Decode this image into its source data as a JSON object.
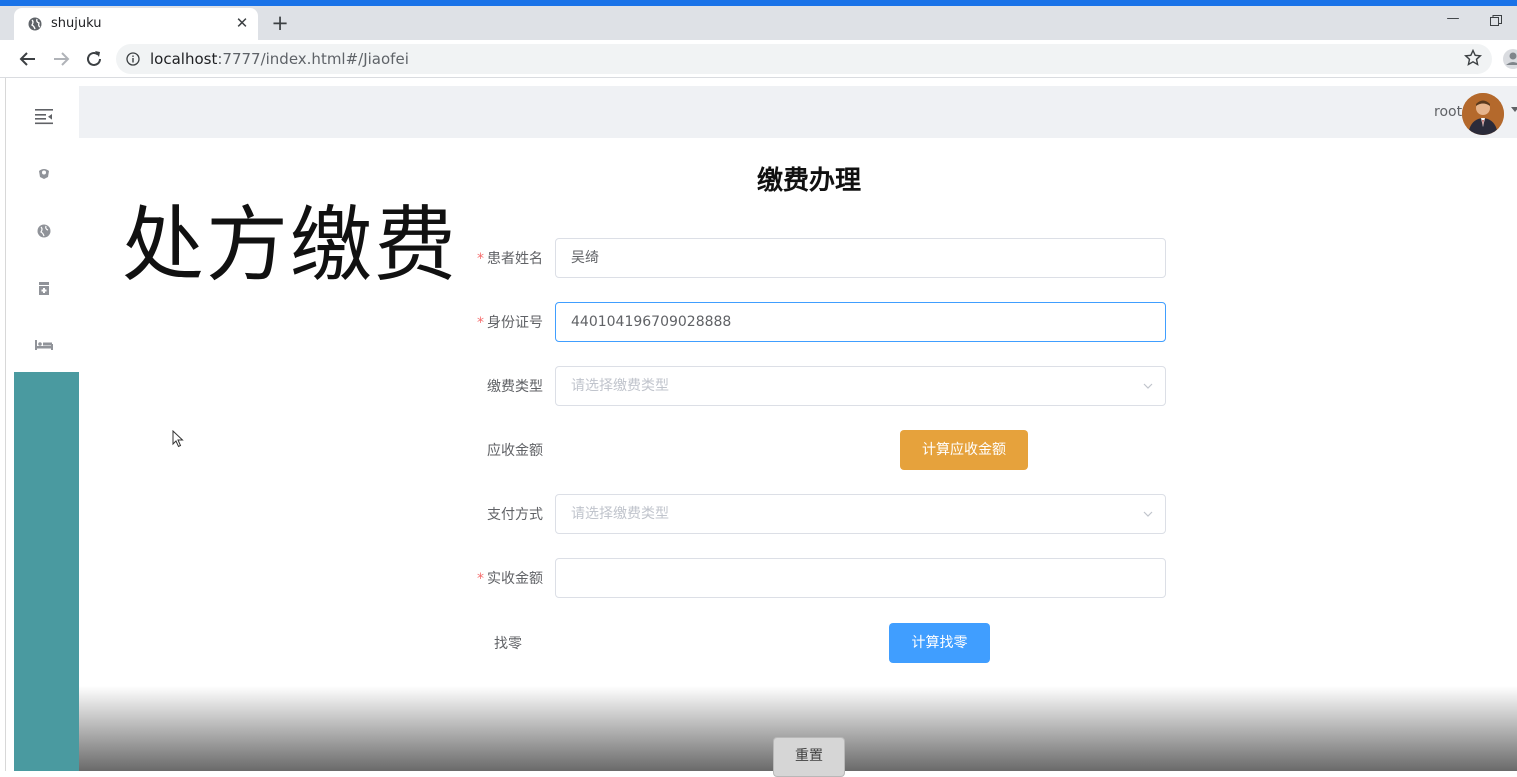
{
  "browser": {
    "tab_title": "shujuku",
    "tab_close": "✕",
    "new_tab": "+",
    "minimize": "—",
    "url_host": "localhost",
    "url_rest": ":7777/index.html#/Jiaofei"
  },
  "header": {
    "username": "root"
  },
  "sidebar": {
    "items": [
      {
        "icon": "menu-fold-icon"
      },
      {
        "icon": "user-shield-icon"
      },
      {
        "icon": "globe-icon"
      },
      {
        "icon": "medicine-box-icon"
      },
      {
        "icon": "bed-icon"
      }
    ],
    "accent_color": "#4a9aa0"
  },
  "main": {
    "big_title": "处方缴费",
    "form_title": "缴费办理",
    "fields": {
      "patient_name": {
        "label": "患者姓名",
        "value": "吴绮",
        "required": true
      },
      "id_number": {
        "label": "身份证号",
        "value": "440104196709028888",
        "required": true
      },
      "fee_type": {
        "label": "缴费类型",
        "placeholder": "请选择缴费类型"
      },
      "receivable": {
        "label": "应收金额"
      },
      "payment_method": {
        "label": "支付方式",
        "placeholder": "请选择缴费类型"
      },
      "actual_amount": {
        "label": "实收金额",
        "value": "",
        "required": true
      },
      "change": {
        "label": "找零"
      }
    },
    "required_mark": "*",
    "calc_receivable_button": "计算应收金额",
    "calc_change_button": "计算找零",
    "reset_button": "重置"
  },
  "colors": {
    "primary": "#409eff",
    "warning": "#e6a23c",
    "required": "#f56c6c",
    "chrome_accent": "#1a73e8"
  }
}
